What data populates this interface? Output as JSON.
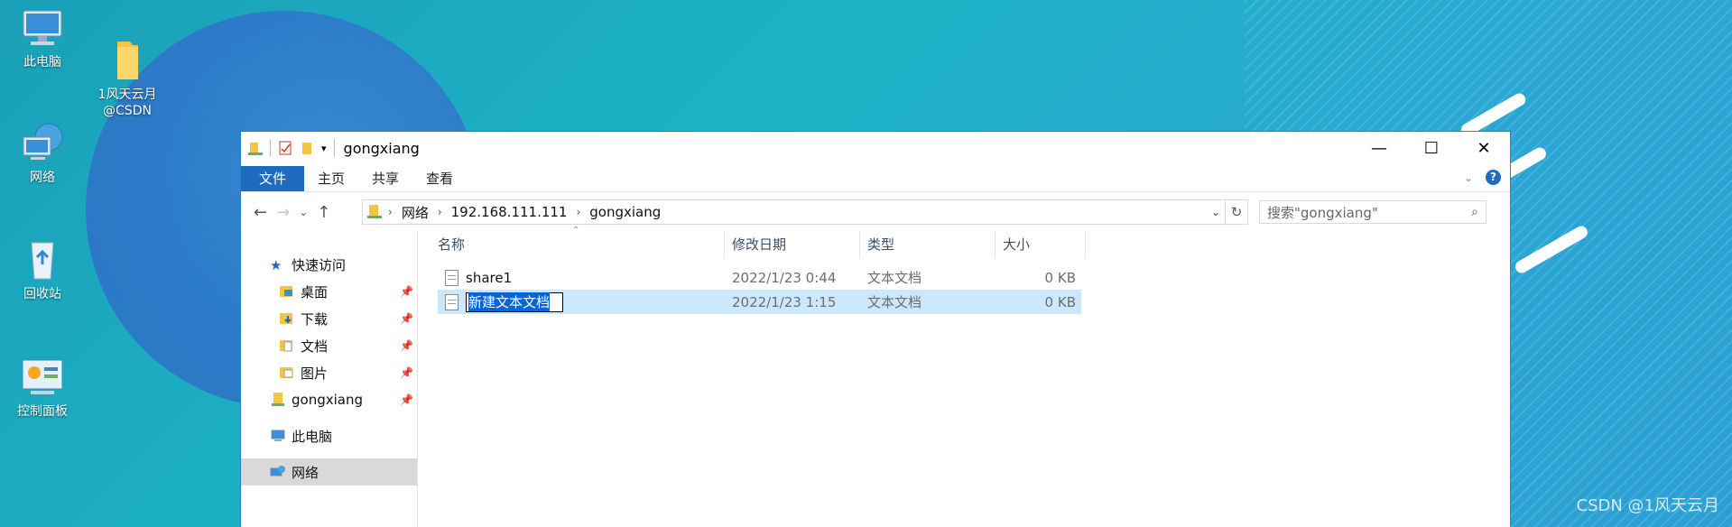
{
  "desktop": {
    "icons": [
      {
        "label": "此电脑",
        "icon": "computer-icon"
      },
      {
        "label": "1风天云月\n@CSDN",
        "icon": "folder-icon"
      },
      {
        "label": "网络",
        "icon": "network-globe-icon"
      },
      {
        "label": "回收站",
        "icon": "recycle-bin-icon"
      },
      {
        "label": "控制面板",
        "icon": "control-panel-icon"
      }
    ],
    "watermark": "CSDN @1风天云月"
  },
  "window": {
    "title": "gongxiang",
    "controls": {
      "minimize": "—",
      "maximize": "☐",
      "close": "✕"
    }
  },
  "ribbon": {
    "tabs": [
      "文件",
      "主页",
      "共享",
      "查看"
    ],
    "help": "?"
  },
  "address": {
    "segments": [
      "网络",
      "192.168.111.111",
      "gongxiang"
    ],
    "search_placeholder": "搜索\"gongxiang\""
  },
  "navpane": {
    "quick_access": "快速访问",
    "items": [
      {
        "label": "桌面",
        "icon": "desktop-folder-icon",
        "pinned": true
      },
      {
        "label": "下载",
        "icon": "download-folder-icon",
        "pinned": true
      },
      {
        "label": "文档",
        "icon": "documents-folder-icon",
        "pinned": true
      },
      {
        "label": "图片",
        "icon": "pictures-folder-icon",
        "pinned": true
      },
      {
        "label": "gongxiang",
        "icon": "network-folder-icon",
        "pinned": true
      }
    ],
    "this_pc": "此电脑",
    "network": "网络"
  },
  "columns": [
    "名称",
    "修改日期",
    "类型",
    "大小"
  ],
  "files": [
    {
      "name": "share1",
      "modified": "2022/1/23 0:44",
      "type": "文本文档",
      "size": "0 KB",
      "selected": false
    },
    {
      "name": "新建文本文档",
      "modified": "2022/1/23 1:15",
      "type": "文本文档",
      "size": "0 KB",
      "selected": true,
      "renaming": true
    }
  ],
  "colors": {
    "accent": "#1f6bbf",
    "selection": "#cce8ff"
  }
}
